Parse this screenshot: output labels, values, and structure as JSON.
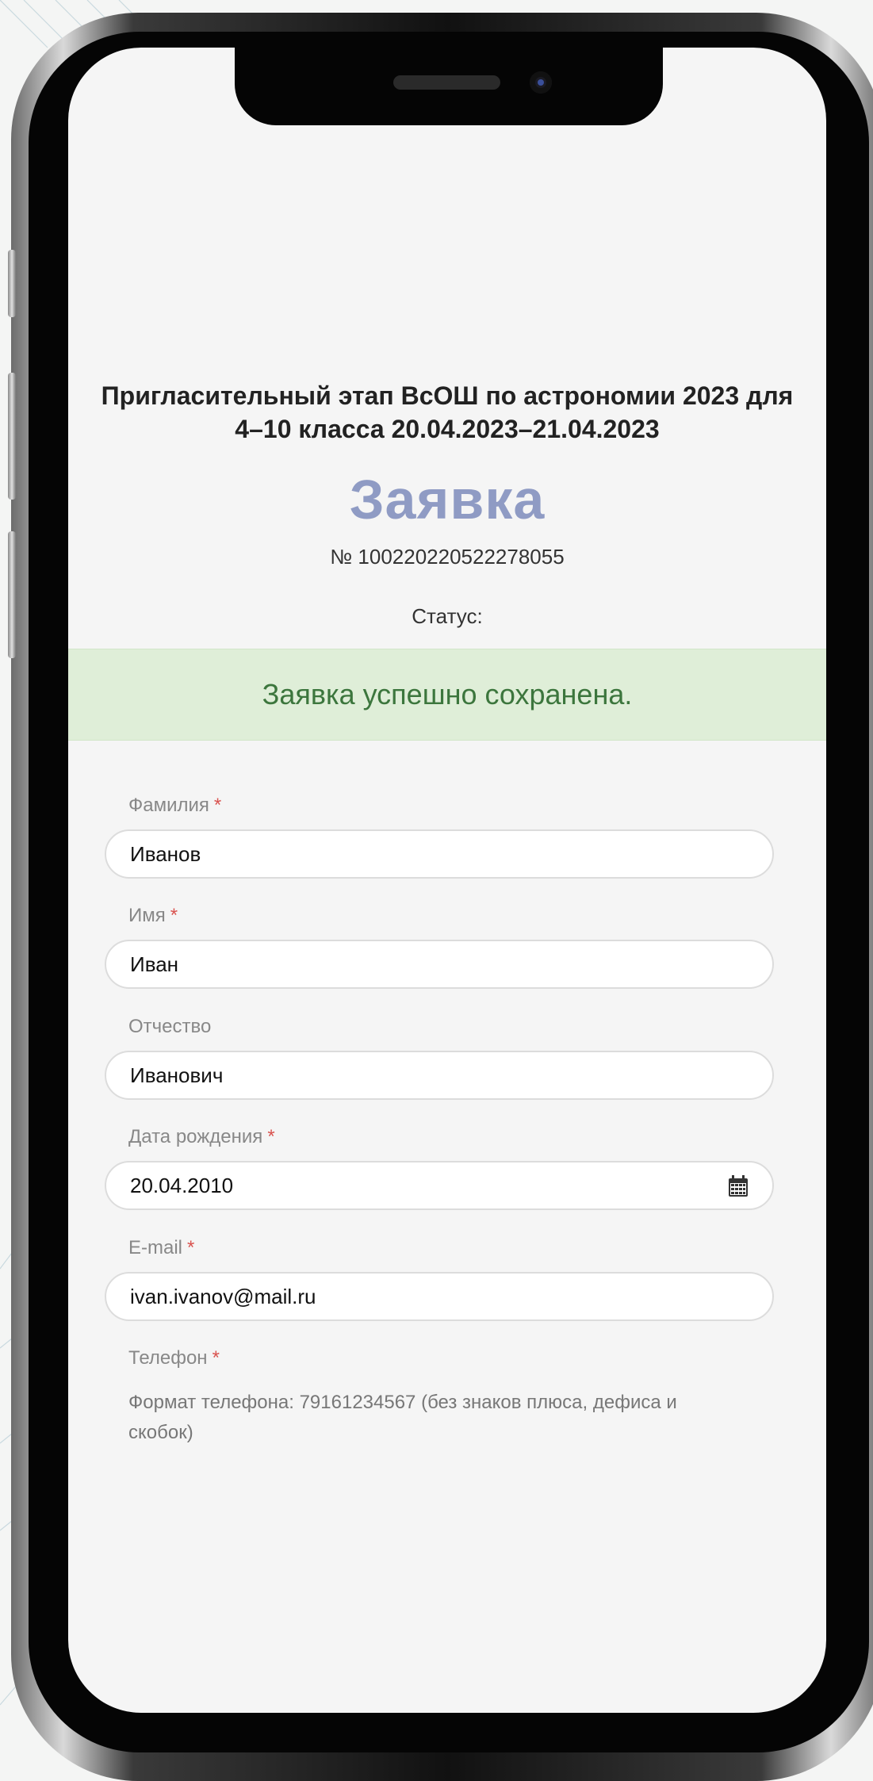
{
  "page": {
    "title": "Пригласительный этап ВсОШ по астрономии 2023 для 4–10 класса 20.04.2023–21.04.2023",
    "heading": "Заявка",
    "number": "№ 100220220522278055",
    "status_label": "Статус:",
    "alert": "Заявка успешно сохранена."
  },
  "form": {
    "required_mark": "*",
    "last_name": {
      "label": "Фамилия",
      "value": "Иванов"
    },
    "first_name": {
      "label": "Имя",
      "value": "Иван"
    },
    "patronymic": {
      "label": "Отчество",
      "value": "Иванович"
    },
    "birth_date": {
      "label": "Дата рождения",
      "value": "20.04.2010",
      "icon": "calendar-icon"
    },
    "email": {
      "label": "E-mail",
      "value": "ivan.ivanov@mail.ru"
    },
    "phone": {
      "label": "Телефон",
      "hint": "Формат телефона: 79161234567 (без знаков плюса, дефиса и скобок)"
    }
  },
  "colors": {
    "heading": "#8f9bc4",
    "alert_bg": "#dfeed8",
    "alert_text": "#3c763d",
    "required": "#d9534f"
  }
}
